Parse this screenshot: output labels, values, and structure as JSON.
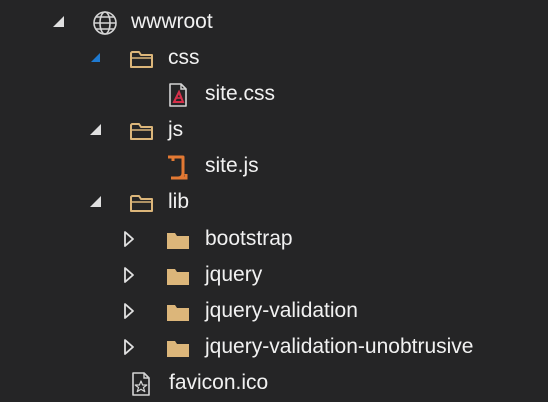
{
  "tree": {
    "items": [
      {
        "label": "wwwroot",
        "icon": "globe-icon",
        "arrow": "expanded"
      },
      {
        "label": "css",
        "icon": "folder-open-icon",
        "arrow": "expanded-selected"
      },
      {
        "label": "site.css",
        "icon": "css-file-icon"
      },
      {
        "label": "js",
        "icon": "folder-open-icon",
        "arrow": "expanded"
      },
      {
        "label": "site.js",
        "icon": "js-file-icon"
      },
      {
        "label": "lib",
        "icon": "folder-open-icon",
        "arrow": "expanded"
      },
      {
        "label": "bootstrap",
        "icon": "folder-icon",
        "arrow": "collapsed"
      },
      {
        "label": "jquery",
        "icon": "folder-icon",
        "arrow": "collapsed"
      },
      {
        "label": "jquery-validation",
        "icon": "folder-icon",
        "arrow": "collapsed"
      },
      {
        "label": "jquery-validation-unobtrusive",
        "icon": "folder-icon",
        "arrow": "collapsed"
      },
      {
        "label": "favicon.ico",
        "icon": "image-file-icon"
      }
    ]
  },
  "colors": {
    "background": "#252526",
    "text": "#f1f1f1",
    "folder": "#dcb67a",
    "expand_arrow": "#e0e0e0",
    "selected_arrow": "#1e7ad1",
    "js_accent": "#e37933",
    "css_accent": "#d7304a"
  }
}
